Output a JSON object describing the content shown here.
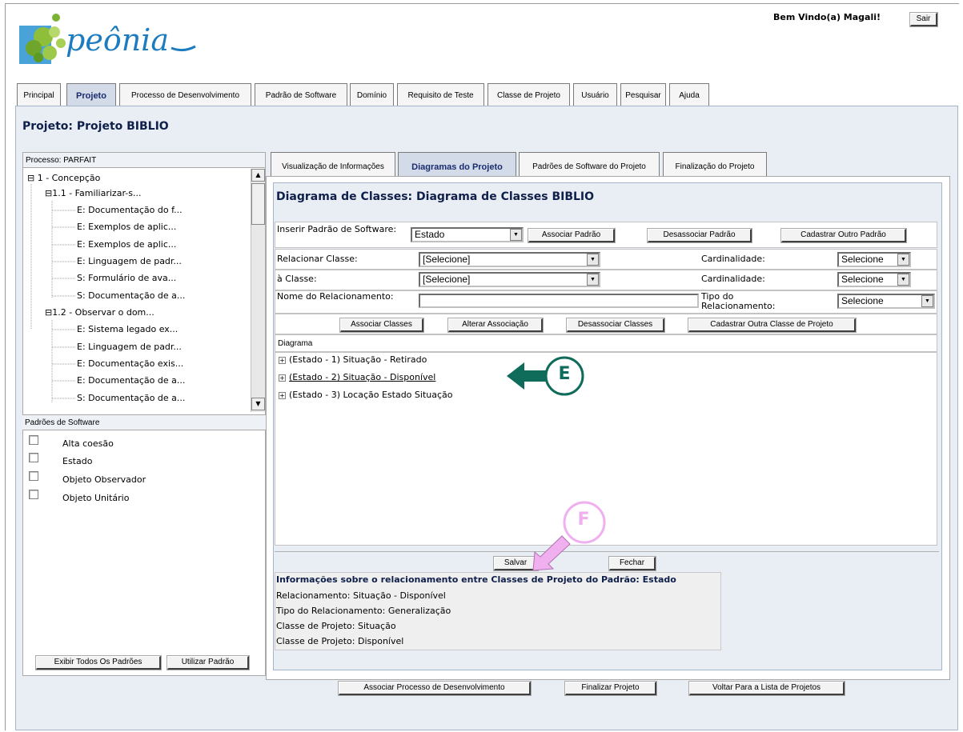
{
  "logo": {
    "text": "peônia"
  },
  "header": {
    "welcome": "Bem Vindo(a) Magali!",
    "logout_label": "Sair"
  },
  "main_tabs": [
    {
      "label": "Principal",
      "active": false
    },
    {
      "label": "Projeto",
      "active": true
    },
    {
      "label": "Processo de Desenvolvimento",
      "active": false
    },
    {
      "label": "Padrão de Software",
      "active": false
    },
    {
      "label": "Domínio",
      "active": false
    },
    {
      "label": "Requisito de Teste",
      "active": false
    },
    {
      "label": "Classe de Projeto",
      "active": false
    },
    {
      "label": "Usuário",
      "active": false
    },
    {
      "label": "Pesquisar",
      "active": false
    },
    {
      "label": "Ajuda",
      "active": false
    }
  ],
  "page_title": "Projeto: Projeto BIBLIO",
  "process": {
    "header": "Processo: PARFAIT",
    "tree": [
      {
        "toggle": "⊟",
        "label": "1 - Concepção"
      },
      {
        "toggle": "⊟",
        "label": "1.1 - Familiarizar-s..."
      },
      {
        "label": "E: Documentação do f..."
      },
      {
        "label": "E: Exemplos de aplic..."
      },
      {
        "label": "E: Exemplos de aplic..."
      },
      {
        "label": "E: Linguagem de padr..."
      },
      {
        "label": "S: Formulário de ava..."
      },
      {
        "label": "S: Documentação de a..."
      },
      {
        "toggle": "⊟",
        "label": "1.2 - Observar o dom..."
      },
      {
        "label": "E: Sistema legado ex..."
      },
      {
        "label": "E: Linguagem de padr..."
      },
      {
        "label": "E: Documentação exis..."
      },
      {
        "label": "E: Documentação de a..."
      },
      {
        "label": "S: Documentação de a..."
      }
    ]
  },
  "patterns": {
    "header": "Padrões de Software",
    "items": [
      "Alta coesão",
      "Estado",
      "Objeto Observador",
      "Objeto Unitário"
    ],
    "show_all_label": "Exibir Todos Os Padrões",
    "use_label": "Utilizar Padrão"
  },
  "sub_tabs": [
    {
      "label": "Visualização de Informações",
      "active": false
    },
    {
      "label": "Diagramas do Projeto",
      "active": true
    },
    {
      "label": "Padrões de Software do Projeto",
      "active": false
    },
    {
      "label": "Finalização do Projeto",
      "active": false
    }
  ],
  "diagram_title": "Diagrama de Classes: Diagrama de Classes BIBLIO",
  "form": {
    "insert_pattern_label": "Inserir Padrão de Software:",
    "insert_pattern_value": "Estado",
    "associate_pattern": "Associar Padrão",
    "dissociate_pattern": "Desassociar Padrão",
    "register_pattern": "Cadastrar Outro Padrão",
    "relate_class_label": "Relacionar Classe:",
    "relate_class_value": "[Selecione]",
    "to_class_label": "à Classe:",
    "to_class_value": "[Selecione]",
    "cardinality_label": "Cardinalidade:",
    "cardinality_value": "Selecione",
    "rel_name_label": "Nome do Relacionamento:",
    "rel_name_value": "",
    "rel_type_label": "Tipo do Relacionamento:",
    "rel_type_value": "Selecione",
    "associate_classes": "Associar Classes",
    "alter_association": "Alterar Associação",
    "dissociate_classes": "Desassociar Classes",
    "register_class": "Cadastrar Outra Classe de Projeto"
  },
  "diagram": {
    "header": "Diagrama",
    "items": [
      {
        "label": "(Estado - 1) Situação - Retirado",
        "underlined": false
      },
      {
        "label": "(Estado - 2) Situação - Disponível",
        "underlined": true
      },
      {
        "label": "(Estado - 3) Locação Estado Situação",
        "underlined": false
      }
    ]
  },
  "annotations": {
    "e_label": "E",
    "f_label": "F",
    "e_color": "#0f6b5a",
    "f_color": "#f0b0f0"
  },
  "actions": {
    "save": "Salvar",
    "close": "Fechar"
  },
  "info": {
    "title": "Informações sobre o relacionamento entre Classes de Projeto do Padrão: Estado",
    "lines": [
      "Relacionamento: Situação - Disponível",
      "Tipo do Relacionamento: Generalização",
      "Classe de Projeto: Situação",
      "Classe de Projeto: Disponível"
    ]
  },
  "bottom": {
    "associate_process": "Associar Processo de Desenvolvimento",
    "finish_project": "Finalizar Projeto",
    "back_list": "Voltar Para a Lista de Projetos"
  }
}
